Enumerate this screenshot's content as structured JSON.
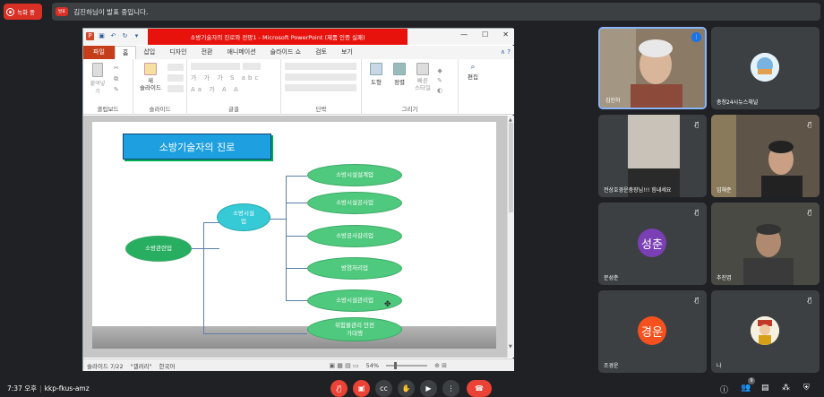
{
  "top": {
    "record_label": "녹화 중",
    "present_badge": "발표",
    "present_text": "김진하님이 발표 중입니다."
  },
  "ppt": {
    "title": "소방기술자의 진로와 전망1 - Microsoft PowerPoint (제품 인증 실패)",
    "tabs": [
      "파일",
      "홈",
      "삽입",
      "디자인",
      "전환",
      "애니메이션",
      "슬라이드 쇼",
      "검토",
      "보기"
    ],
    "ribbon": {
      "paste": "붙여넣기",
      "new_slide": "새\n슬라이드",
      "shape": "도형",
      "arrange": "정렬",
      "quick_style": "빠른\n스타일",
      "edit": "편집",
      "groups": [
        "클립보드",
        "슬라이드",
        "글꼴",
        "단락",
        "그리기"
      ]
    },
    "slide": {
      "title": "소방기술자의 진로",
      "root": "소방관련업",
      "mid": "소방시설\n업",
      "leaves": [
        "소방시설설계업",
        "소방시설공사업",
        "소방공사감리업",
        "방염처리업",
        "소방시설관리업",
        "위험물관리 안전\n가대행"
      ]
    },
    "status": {
      "slide": "슬라이드 7/22",
      "theme": "\"갤러리\"",
      "lang": "한국어",
      "zoom": "54%"
    }
  },
  "participants": [
    {
      "name": "김진하"
    },
    {
      "name": "충청24시뉴스채널"
    },
    {
      "name": "전상호경운충장님!!! 힘내세요"
    },
    {
      "name": "임해준"
    },
    {
      "name": "문성춘",
      "initials": "성춘"
    },
    {
      "name": "추진엽"
    },
    {
      "name": "조경운",
      "initials": "경운"
    },
    {
      "name": "나"
    }
  ],
  "bottom": {
    "time": "7:37 오후",
    "meeting_code": "kkp-fkus-amz",
    "people_count": "9"
  }
}
